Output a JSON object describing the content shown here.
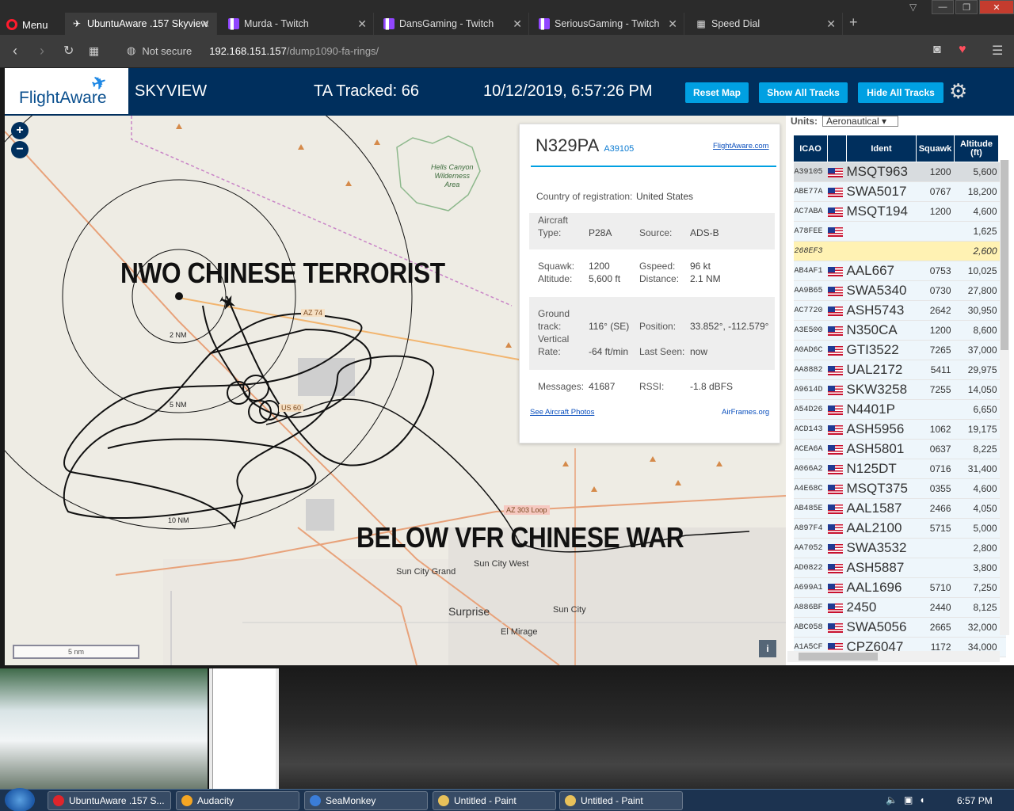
{
  "browser": {
    "menu_label": "Menu",
    "tabs": [
      {
        "title": "UbuntuAware .157 Skyview",
        "icon": "plane-icon"
      },
      {
        "title": "Murda - Twitch",
        "icon": "twitch-icon"
      },
      {
        "title": "DansGaming - Twitch",
        "icon": "twitch-icon"
      },
      {
        "title": "SeriousGaming - Twitch",
        "icon": "twitch-icon"
      },
      {
        "title": "Speed Dial",
        "icon": "grid-icon"
      }
    ],
    "security": "Not secure",
    "url_host": "192.168.151.157",
    "url_path": "/dump1090-fa-rings/"
  },
  "header": {
    "logo": "FlightAware",
    "app_title": "SKYVIEW",
    "tracked": "TA Tracked: 66",
    "datetime": "10/12/2019, 6:57:26 PM",
    "reset_btn": "Reset Map",
    "show_btn": "Show All Tracks",
    "hide_btn": "Hide All Tracks"
  },
  "map": {
    "overlay_top": "NWO CHINESE TERRORIST",
    "overlay_bottom": "BELOW VFR CHINESE WAR",
    "ring_labels": [
      "2 NM",
      "5 NM",
      "10 NM"
    ],
    "road_labels": [
      "AZ 74",
      "US 60",
      "AZ 303 Loop"
    ],
    "area_label": [
      "Hells Canyon",
      "Wilderness",
      "Area"
    ],
    "places": [
      "Sun City West",
      "Sun City Grand",
      "Surprise",
      "Sun City",
      "El Mirage"
    ],
    "scale": "5 nm",
    "info_btn": "i"
  },
  "info": {
    "registration": "N329PA",
    "hex": "A39105",
    "fa_link": "FlightAware.com",
    "country_label": "Country of registration:",
    "country": "United States",
    "aircraft_type_label": "Aircraft Type:",
    "aircraft_label_1": "Aircraft",
    "aircraft_label_2": "Type:",
    "aircraft_type": "P28A",
    "source_label": "Source:",
    "source": "ADS-B",
    "squawk_label": "Squawk:",
    "squawk": "1200",
    "gspeed_label": "Gspeed:",
    "gspeed": "96 kt",
    "altitude_label": "Altitude:",
    "altitude": "5,600 ft",
    "distance_label": "Distance:",
    "distance": "2.1 NM",
    "track_label_1": "Ground",
    "track_label_2": "track:",
    "track": "116° (SE)",
    "position_label": "Position:",
    "position": "33.852°, -112.579°",
    "vr_label_1": "Vertical",
    "vr_label_2": "Rate:",
    "vr": "-64 ft/min",
    "lastseen_label": "Last Seen:",
    "lastseen": "now",
    "messages_label": "Messages:",
    "messages": "41687",
    "rssi_label": "RSSI:",
    "rssi": "-1.8 dBFS",
    "photos_link": "See Aircraft Photos",
    "airframes_link": "AirFrames.org"
  },
  "table": {
    "units_label": "Units:",
    "units_value": "Aeronautical",
    "headers": {
      "icao": "ICAO",
      "ident": "Ident",
      "squawk": "Squawk",
      "alt_1": "Altitude",
      "alt_2": "(ft)"
    },
    "rows": [
      {
        "icao": "A39105",
        "ident": "MSQT963",
        "squawk": "1200",
        "alt": "5,600",
        "vr": "",
        "flag": true,
        "state": "selected"
      },
      {
        "icao": "ABE77A",
        "ident": "SWA5017",
        "squawk": "0767",
        "alt": "18,200",
        "vr": "▲",
        "flag": true,
        "state": ""
      },
      {
        "icao": "AC7ABA",
        "ident": "MSQT194",
        "squawk": "1200",
        "alt": "4,600",
        "vr": "",
        "flag": true,
        "state": ""
      },
      {
        "icao": "A78FEE",
        "ident": "",
        "squawk": "",
        "alt": "1,625",
        "vr": "",
        "flag": true,
        "state": ""
      },
      {
        "icao": "268EF3",
        "ident": "",
        "squawk": "",
        "alt": "2,600",
        "vr": "▲",
        "flag": false,
        "state": "highlight"
      },
      {
        "icao": "AB4AF1",
        "ident": "AAL667",
        "squawk": "0753",
        "alt": "10,025",
        "vr": "▲",
        "flag": true,
        "state": ""
      },
      {
        "icao": "AA9B65",
        "ident": "SWA5340",
        "squawk": "0730",
        "alt": "27,800",
        "vr": "▲",
        "flag": true,
        "state": ""
      },
      {
        "icao": "AC7720",
        "ident": "ASH5743",
        "squawk": "2642",
        "alt": "30,950",
        "vr": "▲",
        "flag": true,
        "state": ""
      },
      {
        "icao": "A3E500",
        "ident": "N350CA",
        "squawk": "1200",
        "alt": "8,600",
        "vr": "",
        "flag": true,
        "state": ""
      },
      {
        "icao": "A0AD6C",
        "ident": "GTI3522",
        "squawk": "7265",
        "alt": "37,000",
        "vr": "",
        "flag": true,
        "state": ""
      },
      {
        "icao": "AA8882",
        "ident": "UAL2172",
        "squawk": "5411",
        "alt": "29,975",
        "vr": "",
        "flag": true,
        "state": ""
      },
      {
        "icao": "A9614D",
        "ident": "SKW3258",
        "squawk": "7255",
        "alt": "14,050",
        "vr": "▼",
        "flag": true,
        "state": ""
      },
      {
        "icao": "A54D26",
        "ident": "N4401P",
        "squawk": "",
        "alt": "6,650",
        "vr": "",
        "flag": true,
        "state": ""
      },
      {
        "icao": "ACD143",
        "ident": "ASH5956",
        "squawk": "1062",
        "alt": "19,175",
        "vr": "▼",
        "flag": true,
        "state": ""
      },
      {
        "icao": "ACEA6A",
        "ident": "ASH5801",
        "squawk": "0637",
        "alt": "8,225",
        "vr": "▼",
        "flag": true,
        "state": ""
      },
      {
        "icao": "A066A2",
        "ident": "N125DT",
        "squawk": "0716",
        "alt": "31,400",
        "vr": "▼",
        "flag": true,
        "state": ""
      },
      {
        "icao": "A4E68C",
        "ident": "MSQT375",
        "squawk": "0355",
        "alt": "4,600",
        "vr": "",
        "flag": true,
        "state": ""
      },
      {
        "icao": "AB485E",
        "ident": "AAL1587",
        "squawk": "2466",
        "alt": "4,050",
        "vr": "▼",
        "flag": true,
        "state": ""
      },
      {
        "icao": "A897F4",
        "ident": "AAL2100",
        "squawk": "5715",
        "alt": "5,000",
        "vr": "▼",
        "flag": true,
        "state": ""
      },
      {
        "icao": "AA7052",
        "ident": "SWA3532",
        "squawk": "",
        "alt": "2,800",
        "vr": "",
        "flag": true,
        "state": ""
      },
      {
        "icao": "AD0822",
        "ident": "ASH5887",
        "squawk": "",
        "alt": "3,800",
        "vr": "",
        "flag": true,
        "state": ""
      },
      {
        "icao": "A699A1",
        "ident": "AAL1696",
        "squawk": "5710",
        "alt": "7,250",
        "vr": "▼",
        "flag": true,
        "state": ""
      },
      {
        "icao": "A886BF",
        "ident": "2450",
        "squawk": "2440",
        "alt": "8,125",
        "vr": "",
        "flag": true,
        "state": ""
      },
      {
        "icao": "ABC058",
        "ident": "SWA5056",
        "squawk": "2665",
        "alt": "32,000",
        "vr": "",
        "flag": true,
        "state": ""
      },
      {
        "icao": "A1A5CF",
        "ident": "CPZ6047",
        "squawk": "1172",
        "alt": "34,000",
        "vr": "",
        "flag": true,
        "state": ""
      }
    ]
  },
  "taskbar": {
    "items": [
      {
        "label": "UbuntuAware .157 S...",
        "color": "#e0252b"
      },
      {
        "label": "Audacity",
        "color": "#f5a623"
      },
      {
        "label": "SeaMonkey",
        "color": "#3b7dd8"
      },
      {
        "label": "Untitled - Paint",
        "color": "#e8c15a"
      },
      {
        "label": "Untitled - Paint",
        "color": "#e8c15a"
      }
    ],
    "clock": "6:57 PM"
  }
}
